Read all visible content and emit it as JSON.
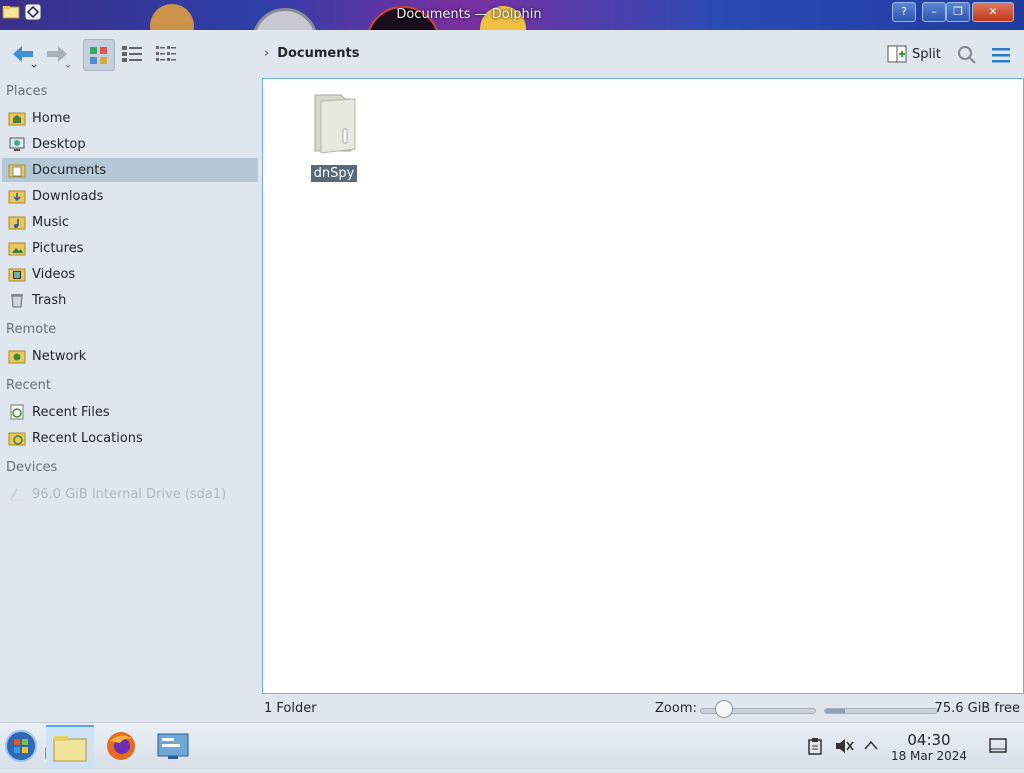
{
  "window": {
    "title": "Documents — Dolphin"
  },
  "toolbar": {
    "back_icon": "arrow-left-icon",
    "forward_icon": "arrow-right-icon",
    "view_modes": [
      "icons-view",
      "details-view",
      "compact-view"
    ],
    "breadcrumb": "Documents",
    "split_label": "Split"
  },
  "sidebar": {
    "sections": [
      {
        "title": "Places",
        "items": [
          {
            "label": "Home",
            "icon": "home-folder-icon"
          },
          {
            "label": "Desktop",
            "icon": "desktop-icon"
          },
          {
            "label": "Documents",
            "icon": "documents-folder-icon",
            "selected": true
          },
          {
            "label": "Downloads",
            "icon": "downloads-folder-icon"
          },
          {
            "label": "Music",
            "icon": "music-folder-icon"
          },
          {
            "label": "Pictures",
            "icon": "pictures-folder-icon"
          },
          {
            "label": "Videos",
            "icon": "videos-folder-icon"
          },
          {
            "label": "Trash",
            "icon": "trash-icon"
          }
        ]
      },
      {
        "title": "Remote",
        "items": [
          {
            "label": "Network",
            "icon": "network-folder-icon"
          }
        ]
      },
      {
        "title": "Recent",
        "items": [
          {
            "label": "Recent Files",
            "icon": "recent-files-icon"
          },
          {
            "label": "Recent Locations",
            "icon": "recent-locations-icon"
          }
        ]
      },
      {
        "title": "Devices",
        "items": [
          {
            "label": "96.0 GiB Internal Drive (sda1)",
            "icon": "drive-icon",
            "dim": true
          }
        ]
      }
    ]
  },
  "files": [
    {
      "name": "dnSpy",
      "type": "folder",
      "selected": true
    }
  ],
  "status": {
    "count": "1 Folder",
    "zoom_label": "Zoom:",
    "zoom_level": 0.2,
    "free_label": "75.6 GiB free",
    "disk_used_fraction": 0.18
  },
  "taskbar": {
    "time": "04:30",
    "date": "18 Mar 2024"
  }
}
